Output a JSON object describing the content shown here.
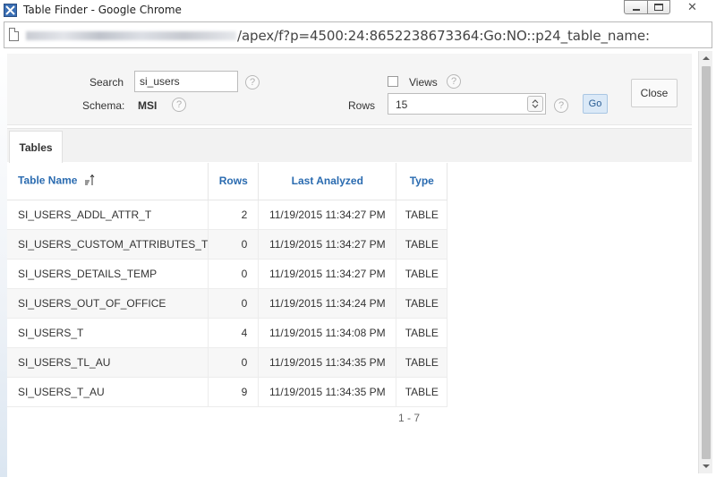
{
  "window": {
    "title": "Table Finder - Google Chrome",
    "close_glyph": "✕"
  },
  "address_bar": {
    "url_visible": "/apex/f?p=4500:24:8652238673364:Go:NO::p24_table_name:"
  },
  "search_form": {
    "search_label": "Search",
    "search_value": "si_users",
    "schema_label": "Schema:",
    "schema_value": "MSI",
    "views_label": "Views",
    "views_checked": false,
    "rows_label": "Rows",
    "rows_value": "15",
    "go_label": "Go",
    "close_label": "Close",
    "help_glyph": "?"
  },
  "tabs": [
    {
      "label": "Tables",
      "active": true
    }
  ],
  "table": {
    "columns": [
      "Table Name",
      "Rows",
      "Last Analyzed",
      "Type"
    ],
    "sorted_column": "Table Name",
    "rows": [
      {
        "name": "SI_USERS_ADDL_ATTR_T",
        "rows": "2",
        "last_analyzed": "11/19/2015 11:34:27 PM",
        "type": "TABLE"
      },
      {
        "name": "SI_USERS_CUSTOM_ATTRIBUTES_T",
        "rows": "0",
        "last_analyzed": "11/19/2015 11:34:27 PM",
        "type": "TABLE"
      },
      {
        "name": "SI_USERS_DETAILS_TEMP",
        "rows": "0",
        "last_analyzed": "11/19/2015 11:34:27 PM",
        "type": "TABLE"
      },
      {
        "name": "SI_USERS_OUT_OF_OFFICE",
        "rows": "0",
        "last_analyzed": "11/19/2015 11:34:24 PM",
        "type": "TABLE"
      },
      {
        "name": "SI_USERS_T",
        "rows": "4",
        "last_analyzed": "11/19/2015 11:34:08 PM",
        "type": "TABLE"
      },
      {
        "name": "SI_USERS_TL_AU",
        "rows": "0",
        "last_analyzed": "11/19/2015 11:34:35 PM",
        "type": "TABLE"
      },
      {
        "name": "SI_USERS_T_AU",
        "rows": "9",
        "last_analyzed": "11/19/2015 11:34:35 PM",
        "type": "TABLE"
      }
    ],
    "pagination": "1 - 7"
  },
  "colors": {
    "link": "#2a6bb0",
    "go_button_bg": "#dbe9f7",
    "region_bg": "#f5f5f5"
  },
  "icons": {
    "app": "table-finder-app-icon",
    "page": "page-icon",
    "sort": "sort-ascending-icon",
    "spinner": "select-spinner-icon"
  }
}
